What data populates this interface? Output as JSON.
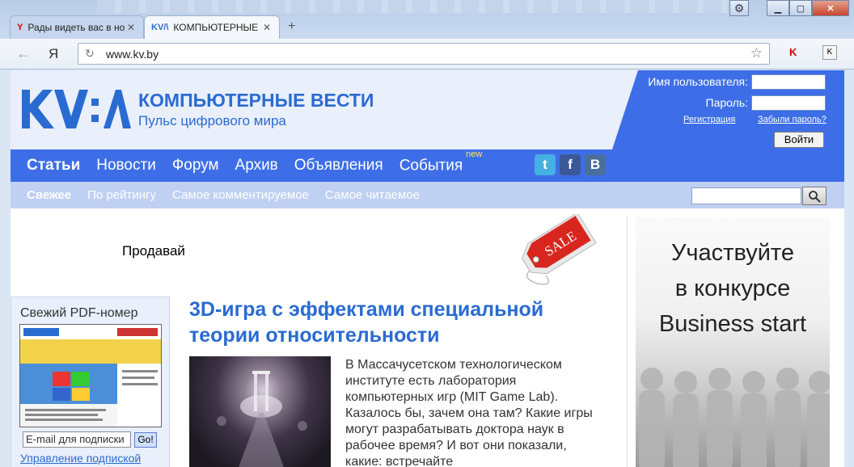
{
  "browser": {
    "tabs": [
      {
        "label": "Рады видеть вас в нов",
        "favicon": "Y"
      },
      {
        "label": "КОМПЬЮТЕРНЫЕ ВЕС",
        "favicon": "KV/\\"
      }
    ],
    "new_tab": "+",
    "address": "www.kv.by",
    "yandex_button": "Я",
    "icons": {
      "back": "back-arrow-icon",
      "reload": "reload-icon",
      "star": "star-icon",
      "settings": "gear-icon"
    }
  },
  "site": {
    "title": "КОМПЬЮТЕРНЫЕ ВЕСТИ",
    "tagline": "Пульс цифрового мира",
    "logo_text": "KV:\\",
    "login": {
      "username_label": "Имя пользователя:",
      "password_label": "Пароль:",
      "register_link": "Регистрация",
      "forgot_link": "Забыли пароль?",
      "login_button": "Войти"
    },
    "nav": [
      "Статьи",
      "Новости",
      "Форум",
      "Архив",
      "Объявления",
      "События"
    ],
    "nav_new_badge": "new",
    "social": [
      "t",
      "f",
      "B"
    ],
    "subnav": [
      "Свежее",
      "По рейтингу",
      "Самое комментируемое",
      "Самое читаемое"
    ],
    "colors": {
      "brand": "#2a6bd1",
      "nav": "#3e6ee7",
      "subnav": "#bfd0f2",
      "new_badge": "#ffe55c"
    }
  },
  "content": {
    "promo_text": "Продавай",
    "sale_tag": "SALE",
    "banner_lines": [
      "Участвуйте",
      "в конкурсе",
      "Business start"
    ],
    "pdf": {
      "title": "Свежий PDF-номер",
      "email_placeholder": "E-mail для подписки",
      "go_button": "Go!",
      "manage_link": "Управление подпиской"
    },
    "article": {
      "headline": "3D-игра с эффектами специальной теории относительности",
      "teaser": "В Массачусетском технологическом институте есть лаборатория компьютерных игр (MIT Game Lab). Казалось бы, зачем она там? Какие игры могут разрабатывать доктора наук в рабочее время? И вот они показали, какие: встречайте"
    }
  }
}
